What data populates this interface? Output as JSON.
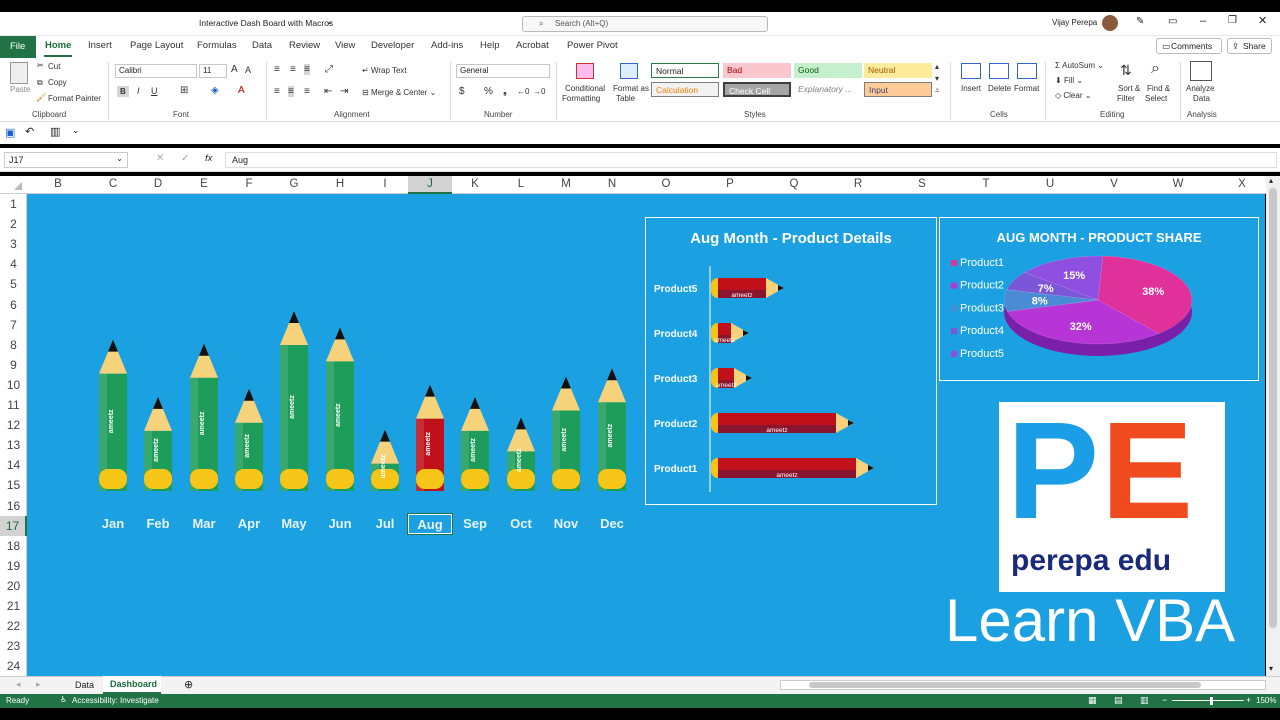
{
  "window": {
    "title": "Interactive Dash Board with Macros",
    "search_placeholder": "Search (Alt+Q)",
    "user": "Vijay Perepa"
  },
  "tabs": [
    "File",
    "Home",
    "Insert",
    "Page Layout",
    "Formulas",
    "Data",
    "Review",
    "View",
    "Developer",
    "Add-ins",
    "Help",
    "Acrobat",
    "Power Pivot"
  ],
  "actions": {
    "comments": "Comments",
    "share": "Share"
  },
  "ribbon": {
    "clipboard": {
      "paste": "Paste",
      "cut": "Cut",
      "copy": "Copy",
      "format_painter": "Format Painter",
      "label": "Clipboard"
    },
    "font": {
      "name": "Calibri",
      "size": "11",
      "label": "Font"
    },
    "alignment": {
      "wrap": "Wrap Text",
      "merge": "Merge & Center",
      "label": "Alignment"
    },
    "number": {
      "format": "General",
      "label": "Number"
    },
    "styles": {
      "conditional": "Conditional",
      "formatting": "Formatting",
      "format_as": "Format as",
      "table": "Table",
      "cells": [
        "Normal",
        "Bad",
        "Good",
        "Neutral",
        "Calculation",
        "Check Cell",
        "Explanatory ...",
        "Input"
      ],
      "label": "Styles"
    },
    "cells": {
      "insert": "Insert",
      "delete": "Delete",
      "format": "Format",
      "label": "Cells"
    },
    "editing": {
      "autosum": "AutoSum",
      "fill": "Fill",
      "clear": "Clear",
      "sort": "Sort &",
      "filter": "Filter",
      "find": "Find &",
      "select": "Select",
      "label": "Editing"
    },
    "analysis": {
      "analyze": "Analyze",
      "data": "Data",
      "label": "Analysis"
    }
  },
  "formula_bar": {
    "name_box": "J17",
    "fx": "fx",
    "content": "Aug"
  },
  "columns": [
    "B",
    "C",
    "D",
    "E",
    "F",
    "G",
    "H",
    "I",
    "J",
    "K",
    "L",
    "M",
    "N",
    "O",
    "P",
    "Q",
    "R",
    "S",
    "T",
    "U",
    "V",
    "W",
    "X"
  ],
  "rows": [
    "1",
    "2",
    "3",
    "4",
    "5",
    "6",
    "7",
    "8",
    "9",
    "10",
    "11",
    "12",
    "13",
    "14",
    "15",
    "16",
    "17",
    "18",
    "19",
    "20",
    "21",
    "22",
    "23",
    "24"
  ],
  "colors": {
    "sheet": "#1ba1e2",
    "pencil_body": "#1e9d5a",
    "pencil_selected": "#c0101a",
    "eraser": "#f5c518",
    "excel_green": "#217346"
  },
  "chart_data": [
    {
      "type": "bar",
      "categories": [
        "Jan",
        "Feb",
        "Mar",
        "Apr",
        "May",
        "Jun",
        "Jul",
        "Aug",
        "Sep",
        "Oct",
        "Nov",
        "Dec"
      ],
      "values": [
        185,
        115,
        180,
        125,
        220,
        200,
        75,
        130,
        115,
        90,
        140,
        150
      ],
      "bar_label": "ameetz",
      "selected": "Aug"
    },
    {
      "type": "bar",
      "orientation": "horizontal",
      "title": "Aug Month - Product Details",
      "categories": [
        "Product5",
        "Product4",
        "Product3",
        "Product2",
        "Product1"
      ],
      "values": [
        60,
        25,
        28,
        130,
        150
      ],
      "bar_label": "ameetz"
    },
    {
      "type": "pie",
      "title": "AUG MONTH - PRODUCT SHARE",
      "categories": [
        "Product1",
        "Product2",
        "Product3",
        "Product4",
        "Product5"
      ],
      "values": [
        38,
        32,
        8,
        7,
        15
      ],
      "colors": [
        "#e0309a",
        "#b734d6",
        "#4a8bd6",
        "#7b56d8",
        "#8f4fe0"
      ]
    }
  ],
  "branding": {
    "logo_letters": "PE",
    "logo_name": "perepa edu",
    "caption": "Learn VBA"
  },
  "sheet_tabs": [
    "Data",
    "Dashboard"
  ],
  "status": {
    "ready": "Ready",
    "accessibility": "Accessibility: Investigate",
    "zoom": "150%"
  }
}
